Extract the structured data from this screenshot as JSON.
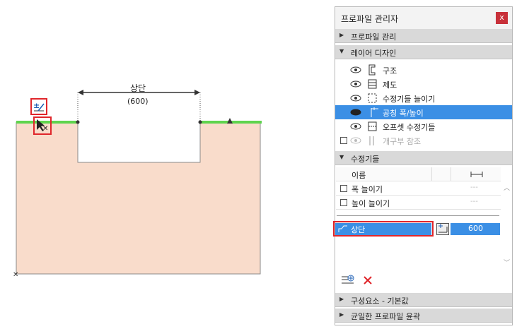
{
  "canvas": {
    "dimension_label": "상단",
    "dimension_value": "(600)",
    "shape_fill": "#f9dccb",
    "edge_color": "#5fd44e",
    "highlight_color": "#e0262b"
  },
  "panel": {
    "title": "프로파일 관리자",
    "close_label": "x",
    "sections": {
      "profile_manage": "프로파일 관리",
      "layer_design": "레이어 디자인",
      "modifiers": "수정기들",
      "component_defaults": "구성요소 - 기본값",
      "uniform_outline": "균일한 프로파일 윤곽"
    },
    "layers": [
      {
        "label": "구조",
        "icon": "structure-icon"
      },
      {
        "label": "제도",
        "icon": "drafting-icon"
      },
      {
        "label": "수정기들 늘이기",
        "icon": "stretch-modifiers-icon"
      },
      {
        "label": "공칭 폭/높이",
        "icon": "nominal-size-icon"
      },
      {
        "label": "오프셋 수정기들",
        "icon": "offset-modifiers-icon"
      },
      {
        "label": "개구부 참조",
        "icon": "opening-reference-icon"
      }
    ],
    "modifier_table": {
      "col_name": "이름",
      "col_icon": "dimension-arrows-icon",
      "rows": [
        {
          "name": "폭 늘이기",
          "value": "---"
        },
        {
          "name": "높이 늘이기",
          "value": "---"
        }
      ]
    },
    "offset_row": {
      "name": "상단",
      "value": "600"
    }
  },
  "colors": {
    "selection": "#3b8fe5",
    "close": "#c8313a",
    "section": "#d9d9d9"
  }
}
